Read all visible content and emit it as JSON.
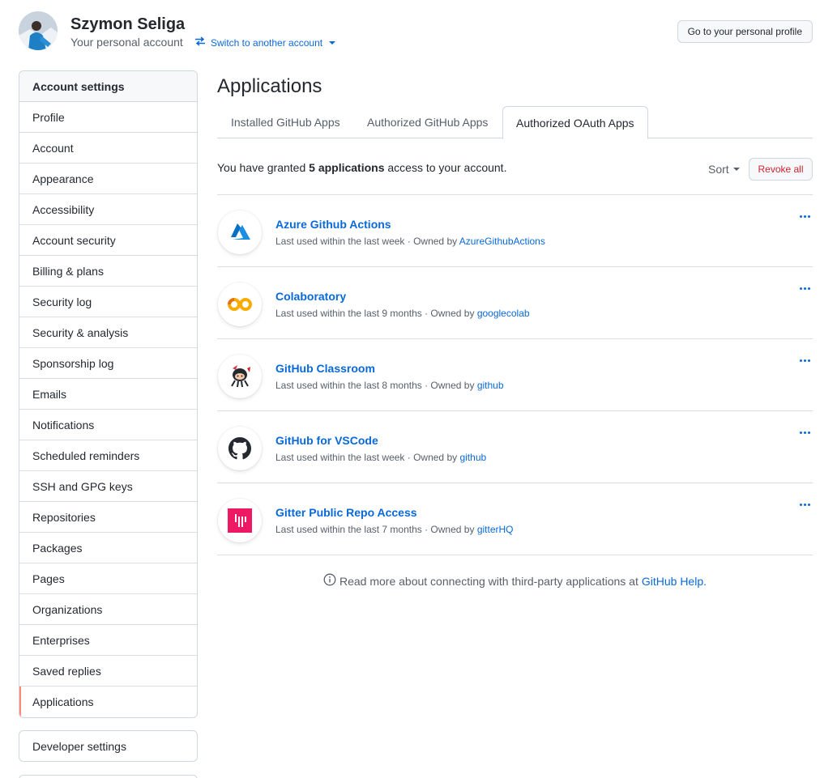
{
  "user": {
    "name": "Szymon Seliga",
    "subtitle": "Your personal account",
    "switch_label": "Switch to another account",
    "profile_button": "Go to your personal profile"
  },
  "sidebar": {
    "heading": "Account settings",
    "items": [
      {
        "label": "Profile"
      },
      {
        "label": "Account"
      },
      {
        "label": "Appearance"
      },
      {
        "label": "Accessibility"
      },
      {
        "label": "Account security"
      },
      {
        "label": "Billing & plans"
      },
      {
        "label": "Security log"
      },
      {
        "label": "Security & analysis"
      },
      {
        "label": "Sponsorship log"
      },
      {
        "label": "Emails"
      },
      {
        "label": "Notifications"
      },
      {
        "label": "Scheduled reminders"
      },
      {
        "label": "SSH and GPG keys"
      },
      {
        "label": "Repositories"
      },
      {
        "label": "Packages"
      },
      {
        "label": "Pages"
      },
      {
        "label": "Organizations"
      },
      {
        "label": "Enterprises"
      },
      {
        "label": "Saved replies"
      },
      {
        "label": "Applications"
      }
    ],
    "selected": "Applications",
    "developer_settings": "Developer settings"
  },
  "main": {
    "title": "Applications",
    "tabs": [
      {
        "label": "Installed GitHub Apps"
      },
      {
        "label": "Authorized GitHub Apps"
      },
      {
        "label": "Authorized OAuth Apps"
      }
    ],
    "active_tab": "Authorized OAuth Apps",
    "granted_prefix": "You have granted",
    "granted_count": "5 applications",
    "granted_suffix": "access to your account.",
    "sort_label": "Sort",
    "revoke_all": "Revoke all",
    "apps": [
      {
        "name": "Azure Github Actions",
        "last_used": "Last used within the last week · Owned by",
        "owner": "AzureGithubActions",
        "icon": "azure-icon"
      },
      {
        "name": "Colaboratory",
        "last_used": "Last used within the last 9 months · Owned by",
        "owner": "googlecolab",
        "icon": "colab-icon"
      },
      {
        "name": "GitHub Classroom",
        "last_used": "Last used within the last 8 months · Owned by",
        "owner": "github",
        "icon": "octocat-classroom-icon"
      },
      {
        "name": "GitHub for VSCode",
        "last_used": "Last used within the last week · Owned by",
        "owner": "github",
        "icon": "github-mark-icon"
      },
      {
        "name": "Gitter Public Repo Access",
        "last_used": "Last used within the last 7 months · Owned by",
        "owner": "gitterHQ",
        "icon": "gitter-icon"
      }
    ],
    "help_text": "Read more about connecting with third-party applications at",
    "help_link": "GitHub Help."
  },
  "colors": {
    "link": "#0969da",
    "danger": "#cf222e",
    "selected_marker": "#fd8c73",
    "border": "#d0d7de"
  }
}
